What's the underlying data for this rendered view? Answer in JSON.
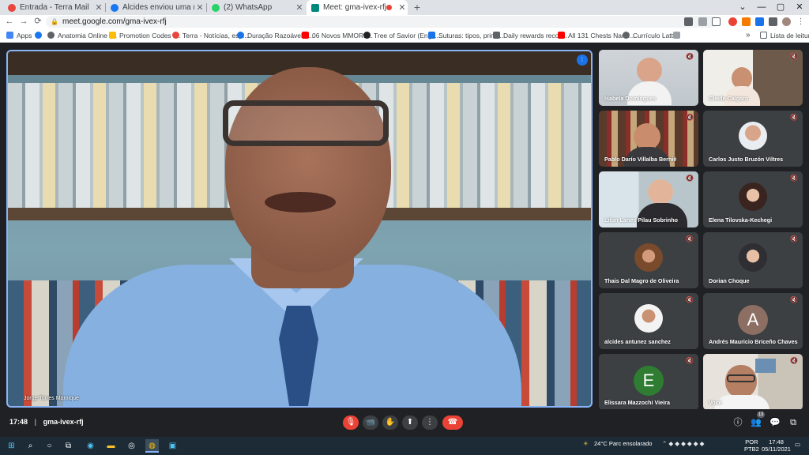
{
  "browser": {
    "tabs": [
      {
        "title": "Entrada - Terra Mail",
        "favicon_color": "#e8453c"
      },
      {
        "title": "Alcides enviou uma mensagem p",
        "favicon_color": "#1877f2"
      },
      {
        "title": "(2) WhatsApp",
        "favicon_color": "#25d366"
      },
      {
        "title": "Meet: gma-ivex-rfj",
        "favicon_color": "#00897b",
        "recording_color": "#ea4335"
      }
    ],
    "new_tab": "+",
    "window_controls": {
      "minimize": "⌄",
      "maximize": "—",
      "restore": "▢",
      "close": "✕"
    },
    "nav": {
      "back": "←",
      "forward": "→",
      "reload": "⟳"
    },
    "url": "meet.google.com/gma-ivex-rfj",
    "bookmarks": [
      {
        "label": "Apps",
        "color": "#4285f4"
      },
      {
        "label": "",
        "color": "#1877f2"
      },
      {
        "label": "Anatomia Online -...",
        "color": "#5f6368"
      },
      {
        "label": "Promotion Codes -...",
        "color": "#fbbc04"
      },
      {
        "label": "Terra - Notícias, esp...",
        "color": "#e8453c"
      },
      {
        "label": "Duração Razoável d...",
        "color": "#1a73e8"
      },
      {
        "label": "06 Novos MMORP...",
        "color": "#ff0000"
      },
      {
        "label": "Tree of Savior (Engli...",
        "color": "#202124"
      },
      {
        "label": "Suturas: tipos, princ...",
        "color": "#1a73e8"
      },
      {
        "label": "Daily rewards recov...",
        "color": "#5f6368"
      },
      {
        "label": "All 131 Chests Nanu...",
        "color": "#ff0000"
      },
      {
        "label": "Currículo Lattes",
        "color": "#5f6368"
      }
    ],
    "more_bookmarks": "»",
    "reading_list": "Lista de leitura"
  },
  "meet": {
    "main_speaker": "Jorge Torres Manrique",
    "participants": [
      {
        "name": "Isabela Domingues",
        "kind": "video"
      },
      {
        "name": "Cleide Calgaro",
        "kind": "video"
      },
      {
        "name": "Pablo Darío Villalba Bernié",
        "kind": "video"
      },
      {
        "name": "Carlos Justo Bruzón Viltres",
        "kind": "avatar"
      },
      {
        "name": "Liton Lanes Pilau Sobrinho",
        "kind": "video"
      },
      {
        "name": "Elena Tilovska-Kechegi",
        "kind": "avatar"
      },
      {
        "name": "Thais Dal Magro de Oliveira",
        "kind": "avatar"
      },
      {
        "name": "Dorian Choque",
        "kind": "avatar"
      },
      {
        "name": "alcides antunez sanchez",
        "kind": "avatar"
      },
      {
        "name": "Andrés Mauricio Briceño Chaves",
        "kind": "letter",
        "letter": "A",
        "color": "#8d6e63"
      },
      {
        "name": "Elissara Mazzochi Vieira",
        "kind": "letter",
        "letter": "E",
        "color": "#2e7d32"
      },
      {
        "name": "Você",
        "kind": "video"
      }
    ],
    "time": "17:48",
    "meeting_code": "gma-ivex-rfj",
    "controls": {
      "mic": "🎙",
      "camera": "📹",
      "hand": "✋",
      "present": "⬆",
      "more": "⋮",
      "hangup": "☎"
    },
    "right_controls": {
      "info": "ⓘ",
      "people": "👥",
      "people_count": "13",
      "chat": "💬",
      "activities": "⧉"
    }
  },
  "taskbar": {
    "weather": "24°C  Parc ensolarado",
    "lang": "POR",
    "lang_sub": "PTB2",
    "clock_time": "17:48",
    "clock_date": "05/11/2021"
  }
}
